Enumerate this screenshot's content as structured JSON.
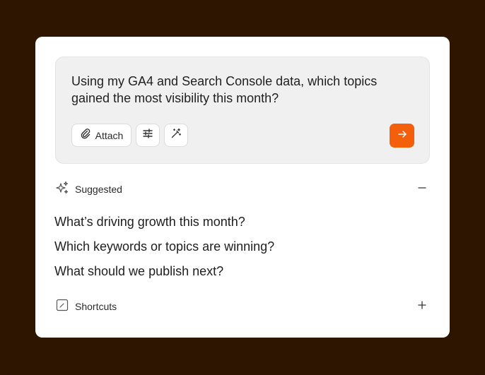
{
  "composer": {
    "prompt_text": "Using my GA4 and Search Console data, which topics gained the most visibility this month?",
    "attach_label": "Attach",
    "icons": {
      "attach": "paperclip-icon",
      "settings": "sliders-icon",
      "magic": "magic-wand-icon",
      "send": "arrow-right-icon"
    },
    "send_color": "#f35f0b"
  },
  "suggested": {
    "label": "Suggested",
    "icon": "sparkles-icon",
    "toggle_icon": "minus-icon",
    "items": [
      "What’s driving growth this month?",
      "Which keywords or topics are winning?",
      "What should we publish next?"
    ]
  },
  "shortcuts": {
    "label": "Shortcuts",
    "icon": "edit-square-icon",
    "toggle_icon": "plus-icon"
  }
}
